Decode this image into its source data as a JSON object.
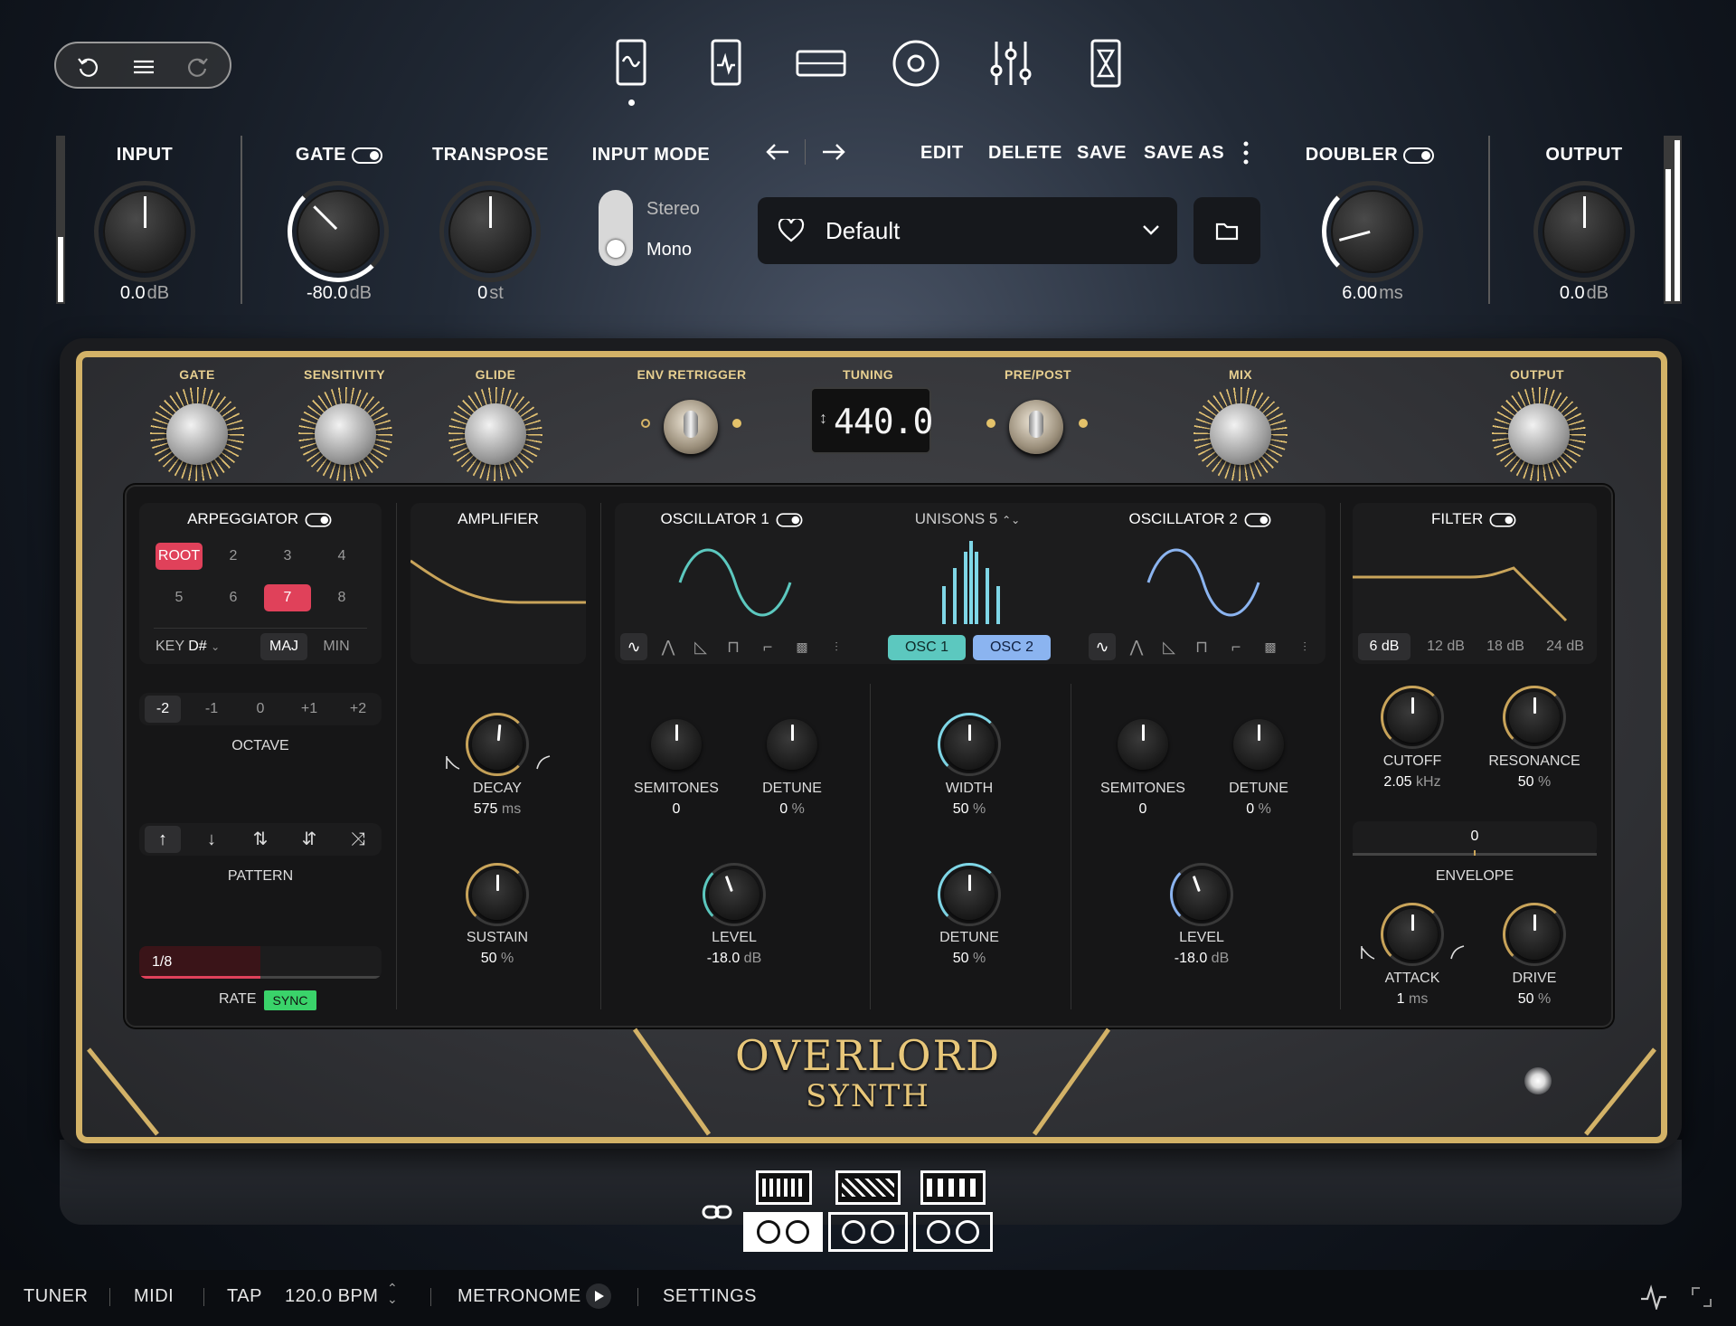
{
  "history": {
    "undo_icon": "undo-icon",
    "menu_icon": "menu-icon",
    "redo_icon": "redo-icon"
  },
  "nav_icons": [
    "amp-icon",
    "pedal-icon",
    "rack-icon",
    "speaker-icon",
    "mixer-icon",
    "timer-icon"
  ],
  "input": {
    "label": "INPUT",
    "value": "0.0",
    "unit": "dB"
  },
  "gate": {
    "label": "GATE",
    "value": "-80.0",
    "unit": "dB"
  },
  "transpose": {
    "label": "TRANSPOSE",
    "value": "0",
    "unit": "st"
  },
  "input_mode": {
    "label": "INPUT MODE",
    "options": [
      "Stereo",
      "Mono"
    ],
    "selected": "Mono"
  },
  "preset": {
    "name": "Default",
    "actions": [
      "EDIT",
      "DELETE",
      "SAVE",
      "SAVE AS"
    ]
  },
  "doubler": {
    "label": "DOUBLER",
    "value": "6.00",
    "unit": "ms"
  },
  "output": {
    "label": "OUTPUT",
    "value": "0.0",
    "unit": "dB"
  },
  "pedal": {
    "controls": [
      "GATE",
      "SENSITIVITY",
      "GLIDE",
      "ENV RETRIGGER",
      "TUNING",
      "PRE/POST",
      "MIX",
      "OUTPUT"
    ],
    "tuning_value": "440.0",
    "title": "OVERLORD",
    "subtitle": "SYNTH"
  },
  "arp": {
    "title": "ARPEGGIATOR",
    "steps": [
      "ROOT",
      "2",
      "3",
      "4",
      "5",
      "6",
      "7",
      "8"
    ],
    "active_steps": [
      "ROOT",
      "7"
    ],
    "key_label": "KEY",
    "key": "D#",
    "scale_options": [
      "MAJ",
      "MIN"
    ],
    "scale": "MAJ",
    "octave_label": "OCTAVE",
    "octaves": [
      "-2",
      "-1",
      "0",
      "+1",
      "+2"
    ],
    "octave": "-2",
    "pattern_label": "PATTERN",
    "rate_label": "RATE",
    "rate": "1/8",
    "sync": "SYNC"
  },
  "amplifier": {
    "title": "AMPLIFIER",
    "decay_label": "DECAY",
    "decay": "575",
    "decay_unit": "ms",
    "sustain_label": "SUSTAIN",
    "sustain": "50",
    "sustain_unit": "%"
  },
  "osc1": {
    "title": "OSCILLATOR 1",
    "semitones_label": "SEMITONES",
    "semitones": "0",
    "detune_label": "DETUNE",
    "detune": "0",
    "detune_unit": "%",
    "level_label": "LEVEL",
    "level": "-18.0",
    "level_unit": "dB"
  },
  "unison": {
    "title": "UNISONS 5",
    "tabs": [
      "OSC 1",
      "OSC 2"
    ],
    "width_label": "WIDTH",
    "width": "50",
    "width_unit": "%",
    "detune_label": "DETUNE",
    "detune": "50",
    "detune_unit": "%"
  },
  "osc2": {
    "title": "OSCILLATOR 2",
    "semitones_label": "SEMITONES",
    "semitones": "0",
    "detune_label": "DETUNE",
    "detune": "0",
    "detune_unit": "%",
    "level_label": "LEVEL",
    "level": "-18.0",
    "level_unit": "dB"
  },
  "filter": {
    "title": "FILTER",
    "slopes": [
      "6 dB",
      "12 dB",
      "18 dB",
      "24 dB"
    ],
    "slope": "6 dB",
    "cutoff_label": "CUTOFF",
    "cutoff": "2.05",
    "cutoff_unit": "kHz",
    "resonance_label": "RESONANCE",
    "resonance": "50",
    "resonance_unit": "%",
    "envelope_value": "0",
    "envelope_label": "ENVELOPE",
    "attack_label": "ATTACK",
    "attack": "1",
    "attack_unit": "ms",
    "drive_label": "DRIVE",
    "drive": "50",
    "drive_unit": "%"
  },
  "bottom": {
    "tuner": "TUNER",
    "midi": "MIDI",
    "tap": "TAP",
    "bpm": "120.0 BPM",
    "metronome": "METRONOME",
    "settings": "SETTINGS"
  },
  "colors": {
    "gold": "#c9a45a",
    "red": "#e0415a",
    "teal": "#5cc8bf",
    "blue": "#8bb4f0",
    "green": "#3ad36a"
  }
}
